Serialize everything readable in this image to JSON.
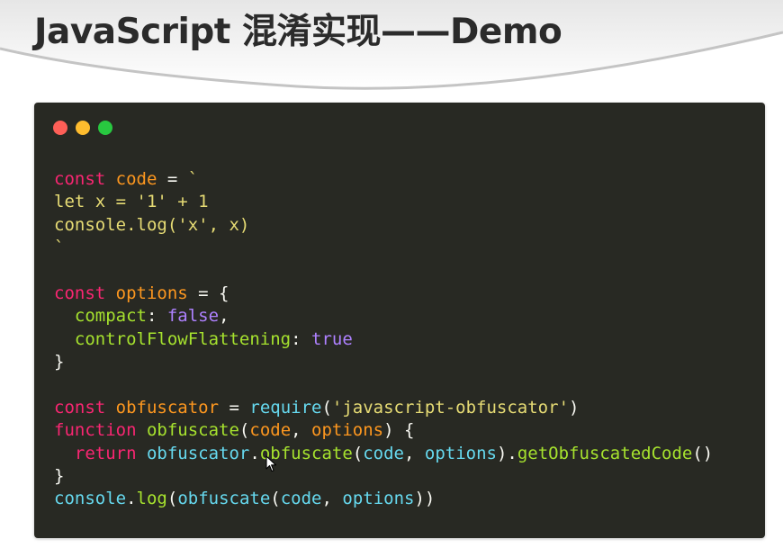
{
  "slide": {
    "title": "JavaScript 混淆实现——Demo"
  },
  "colors": {
    "background": "#ffffff",
    "title": "#2b2b2b",
    "editor_bg": "#282923",
    "dot_red": "#fe5f57",
    "dot_yellow": "#febc2e",
    "dot_green": "#28c840"
  },
  "window_controls": [
    "close-dot",
    "minimize-dot",
    "maximize-dot"
  ],
  "code": {
    "lines": [
      [
        [
          "keyword",
          "const"
        ],
        [
          "plain",
          " "
        ],
        [
          "var",
          "code"
        ],
        [
          "plain",
          " = "
        ],
        [
          "string",
          "`"
        ]
      ],
      [
        [
          "string",
          "let x = '1' + 1"
        ]
      ],
      [
        [
          "string",
          "console.log('x', x)"
        ]
      ],
      [
        [
          "string",
          "`"
        ]
      ],
      [],
      [
        [
          "keyword",
          "const"
        ],
        [
          "plain",
          " "
        ],
        [
          "var",
          "options"
        ],
        [
          "plain",
          " = {"
        ]
      ],
      [
        [
          "plain",
          "  "
        ],
        [
          "prop",
          "compact"
        ],
        [
          "plain",
          ": "
        ],
        [
          "bool",
          "false"
        ],
        [
          "plain",
          ","
        ]
      ],
      [
        [
          "plain",
          "  "
        ],
        [
          "prop",
          "controlFlowFlattening"
        ],
        [
          "plain",
          ": "
        ],
        [
          "bool",
          "true"
        ]
      ],
      [
        [
          "plain",
          "}"
        ]
      ],
      [],
      [
        [
          "keyword",
          "const"
        ],
        [
          "plain",
          " "
        ],
        [
          "var",
          "obfuscator"
        ],
        [
          "plain",
          " = "
        ],
        [
          "builtin",
          "require"
        ],
        [
          "plain",
          "("
        ],
        [
          "string",
          "'javascript-obfuscator'"
        ],
        [
          "plain",
          ")"
        ]
      ],
      [
        [
          "keyword",
          "function"
        ],
        [
          "plain",
          " "
        ],
        [
          "func",
          "obfuscate"
        ],
        [
          "plain",
          "("
        ],
        [
          "param",
          "code"
        ],
        [
          "plain",
          ", "
        ],
        [
          "param",
          "options"
        ],
        [
          "plain",
          ") {"
        ]
      ],
      [
        [
          "plain",
          "  "
        ],
        [
          "keyword",
          "return"
        ],
        [
          "plain",
          " "
        ],
        [
          "builtin",
          "obfuscator"
        ],
        [
          "plain",
          "."
        ],
        [
          "func",
          "obfuscate"
        ],
        [
          "plain",
          "("
        ],
        [
          "builtin",
          "code"
        ],
        [
          "plain",
          ", "
        ],
        [
          "builtin",
          "options"
        ],
        [
          "plain",
          ")."
        ],
        [
          "func",
          "getObfuscatedCode"
        ],
        [
          "plain",
          "()"
        ]
      ],
      [
        [
          "plain",
          "}"
        ]
      ],
      [
        [
          "builtin",
          "console"
        ],
        [
          "plain",
          "."
        ],
        [
          "func",
          "log"
        ],
        [
          "plain",
          "("
        ],
        [
          "builtin",
          "obfuscate"
        ],
        [
          "plain",
          "("
        ],
        [
          "builtin",
          "code"
        ],
        [
          "plain",
          ", "
        ],
        [
          "builtin",
          "options"
        ],
        [
          "plain",
          "))"
        ]
      ]
    ]
  },
  "icons": {
    "mouse_cursor": "arrow-cursor-icon"
  }
}
